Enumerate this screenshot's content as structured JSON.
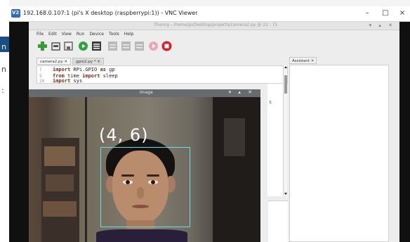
{
  "host": {
    "left_fragments": [
      "n",
      "n",
      ":"
    ]
  },
  "vnc": {
    "window_title": "192.168.0.107:1 (pi's X desktop (raspberrypi:1)) - VNC Viewer",
    "controls": {
      "minimize": "–",
      "maximize": "□",
      "close": "×"
    }
  },
  "thonny": {
    "title": "Thonny  -  /home/pi/Desktop/projects/camera2.py  @  22 : 71",
    "title_controls": "▾ ▴ ✕",
    "menu": [
      "File",
      "Edit",
      "View",
      "Run",
      "Device",
      "Tools",
      "Help"
    ],
    "toolbar": [
      {
        "name": "new",
        "icon": "plus-icon",
        "color": "#3a9a3a"
      },
      {
        "name": "open",
        "icon": "folder-icon",
        "color": "#666666"
      },
      {
        "name": "save",
        "icon": "save-icon",
        "color": "#777777"
      },
      {
        "name": "run",
        "icon": "run-icon",
        "color": "#2ea43a"
      },
      {
        "name": "debug",
        "icon": "debug-icon",
        "color": "#3a3a3a"
      },
      {
        "name": "step-over",
        "icon": "step-over-icon",
        "color": "#b7b7b7"
      },
      {
        "name": "step-into",
        "icon": "step-into-icon",
        "color": "#b7b7b7"
      },
      {
        "name": "step-out",
        "icon": "step-out-icon",
        "color": "#b7b7b7"
      },
      {
        "name": "resume",
        "icon": "resume-icon",
        "color": "#e6a9b5"
      },
      {
        "name": "stop",
        "icon": "stop-icon",
        "color": "#d3212d"
      }
    ],
    "tabs": [
      {
        "label": "camera2.py ✕",
        "active": true
      },
      {
        "label": "gpio2.py * ✕",
        "active": false
      }
    ],
    "editor": {
      "lines": [
        {
          "num": "7",
          "parts": [
            {
              "kw": "import"
            },
            {
              "t": " RPi.GPIO "
            },
            {
              "kw": "as"
            },
            {
              "t": " gp"
            }
          ]
        },
        {
          "num": "9",
          "parts": [
            {
              "kw": "from"
            },
            {
              "t": " time "
            },
            {
              "kw": "import"
            },
            {
              "t": " sleep"
            }
          ]
        },
        {
          "num": "10",
          "parts": [
            {
              "kw": "import"
            },
            {
              "t": " sys"
            }
          ]
        }
      ],
      "side_fragment": "3,"
    },
    "assistant_tab": "Assistant ✕"
  },
  "image_window": {
    "title": "Image",
    "controls": "▾ ▴ ✕",
    "overlay_text": "(4, 6)",
    "bbox_color": "#5fe1e6"
  }
}
